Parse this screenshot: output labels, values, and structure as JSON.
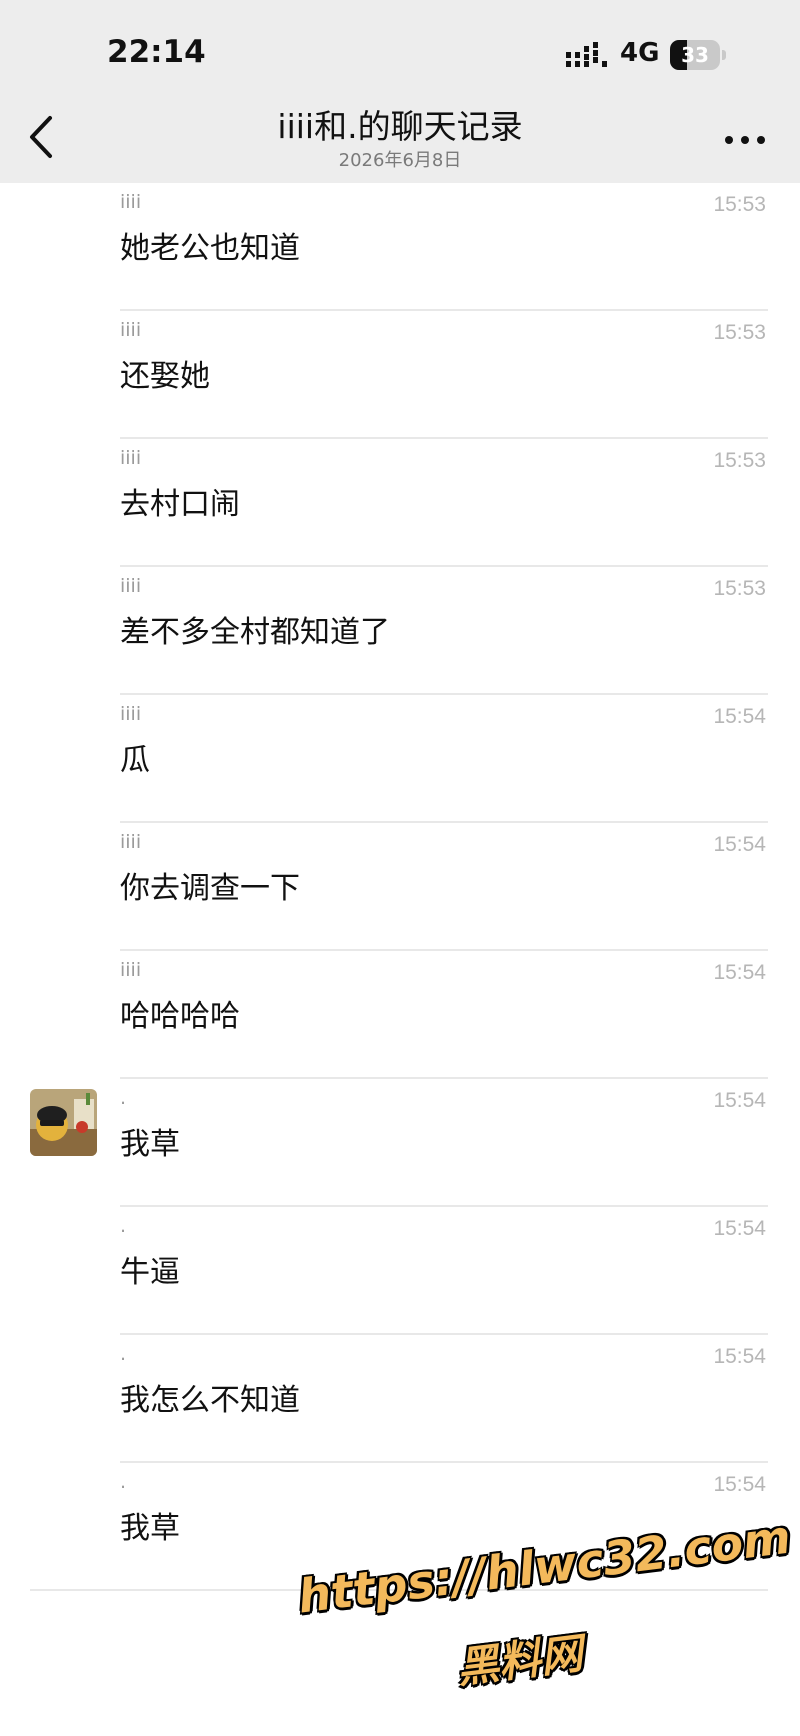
{
  "status_bar": {
    "time": "22:14",
    "network": "4G",
    "battery_level": "33",
    "battery_fraction": 0.33
  },
  "header": {
    "title": "iiii和.的聊天记录",
    "subtitle": "2026年6月8日",
    "back_icon": "chevron-left-icon",
    "more_icon": "more-horizontal-icon"
  },
  "messages": [
    {
      "sender": "iiii",
      "time": "15:53",
      "text": "她老公也知道",
      "avatar": false
    },
    {
      "sender": "iiii",
      "time": "15:53",
      "text": "还娶她",
      "avatar": false
    },
    {
      "sender": "iiii",
      "time": "15:53",
      "text": "去村口闹",
      "avatar": false
    },
    {
      "sender": "iiii",
      "time": "15:53",
      "text": "差不多全村都知道了",
      "avatar": false
    },
    {
      "sender": "iiii",
      "time": "15:54",
      "text": "瓜",
      "avatar": false
    },
    {
      "sender": "iiii",
      "time": "15:54",
      "text": "你去调查一下",
      "avatar": false
    },
    {
      "sender": "iiii",
      "time": "15:54",
      "text": "哈哈哈哈",
      "avatar": false
    },
    {
      "sender": ".",
      "time": "15:54",
      "text": "我草",
      "avatar": true
    },
    {
      "sender": ".",
      "time": "15:54",
      "text": "牛逼",
      "avatar": false
    },
    {
      "sender": ".",
      "time": "15:54",
      "text": "我怎么不知道",
      "avatar": false
    },
    {
      "sender": ".",
      "time": "15:54",
      "text": "我草",
      "avatar": false
    }
  ],
  "watermark": {
    "url": "https://hlwc32.com",
    "text": "黑料网"
  },
  "colors": {
    "header_bg": "#ededed",
    "watermark": "#f3b95b"
  }
}
